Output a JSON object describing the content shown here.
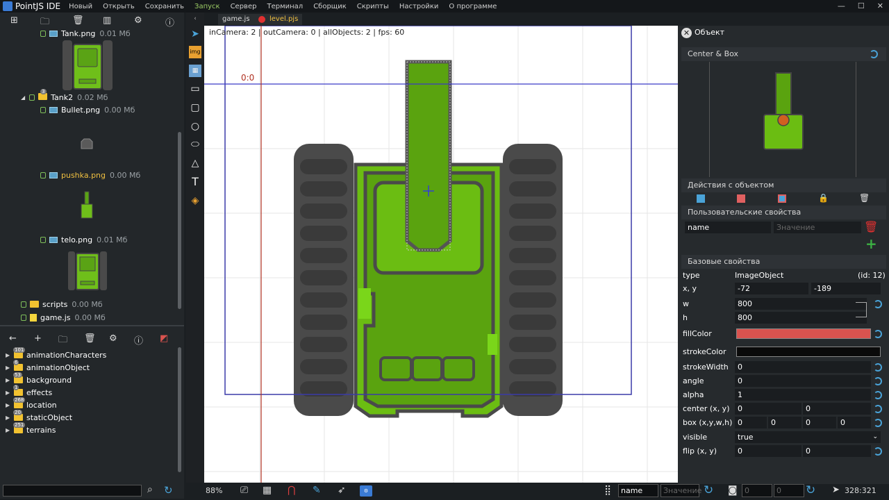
{
  "app": {
    "title": "PointJS IDE"
  },
  "menu": [
    "Новый",
    "Открыть",
    "Сохранить",
    "Запуск",
    "Сервер",
    "Терминал",
    "Сборщик",
    "Скрипты",
    "Настройки",
    "О программе"
  ],
  "file_tree": {
    "items": [
      {
        "name": "Tank.png",
        "size": "0.01 Мб"
      },
      {
        "name": "Tank2",
        "size": "0.02 Мб",
        "count": "3"
      },
      {
        "name": "Bullet.png",
        "size": "0.00 Мб"
      },
      {
        "name": "pushka.png",
        "size": "0.00 Мб"
      },
      {
        "name": "telo.png",
        "size": "0.01 Мб"
      },
      {
        "name": "scripts",
        "size": "0.00 Мб"
      },
      {
        "name": "game.js",
        "size": "0.00 Мб"
      }
    ]
  },
  "library": {
    "items": [
      {
        "name": "animationCharacters",
        "count": "101"
      },
      {
        "name": "animationObject",
        "count": "6"
      },
      {
        "name": "background",
        "count": "53"
      },
      {
        "name": "effects",
        "count": "1"
      },
      {
        "name": "location",
        "count": "268"
      },
      {
        "name": "staticObject",
        "count": "20"
      },
      {
        "name": "terrains",
        "count": "251"
      }
    ]
  },
  "tabs": [
    {
      "label": "game.js"
    },
    {
      "label": "level.pjs"
    }
  ],
  "canvas": {
    "info": "inCamera: 2 | outCamera: 0 | allObjects: 2 | fps: 60",
    "origin": "0:0"
  },
  "status": {
    "zoom": "88%",
    "name": "name",
    "value_placeholder": "Значение",
    "coords": "328:321"
  },
  "panel": {
    "title": "Объект",
    "center_box": "Center & Box",
    "actions": "Действия с объектом",
    "user_props": "Пользовательские свойства",
    "user_name": "name",
    "user_value_placeholder": "Значение",
    "base_props": "Базовые свойства",
    "type_label": "type",
    "type_value": "ImageObject",
    "id": "(id: 12)",
    "xy_label": "x, y",
    "x": "-72",
    "y": "-189",
    "w_label": "w",
    "w": "800",
    "h_label": "h",
    "h": "800",
    "fill_label": "fillColor",
    "fill_color": "#d9534f",
    "stroke_label": "strokeColor",
    "strokeWidth_label": "strokeWidth",
    "strokeWidth": "0",
    "angle_label": "angle",
    "angle": "0",
    "alpha_label": "alpha",
    "alpha": "1",
    "center_label": "center (x, y)",
    "cx": "0",
    "cy": "0",
    "box_label": "box (x,y,w,h)",
    "bx": "0",
    "by": "0",
    "bw": "0",
    "bh": "0",
    "visible_label": "visible",
    "visible": "true",
    "flip_label": "flip (x, y)",
    "fx": "0",
    "fy": "0"
  }
}
